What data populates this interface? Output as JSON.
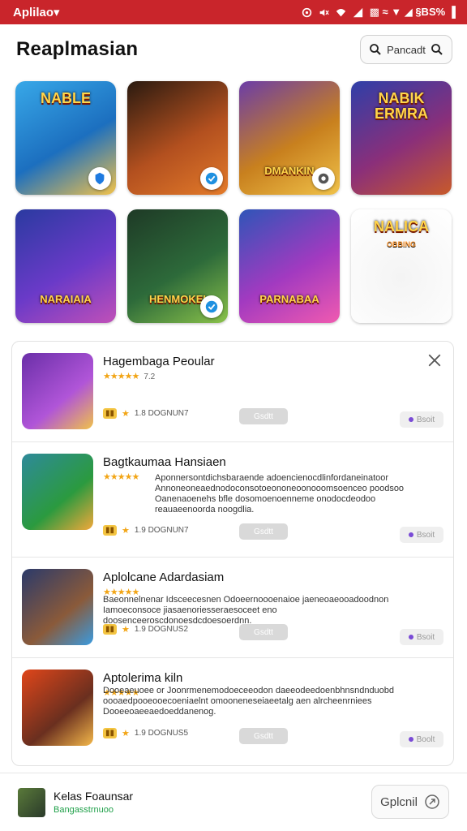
{
  "status_bar": {
    "left": "Aplilao▾",
    "right": "▩ ≈ ▼ ◢ §BS% ▐"
  },
  "header": {
    "title": "Reaplmasian",
    "search_label": "Pancadt"
  },
  "grid": [
    {
      "title": "NABLE",
      "sub": "",
      "icon": "shield-icon",
      "colors": [
        "#38a8e8",
        "#1c6fbf",
        "#f2c24a"
      ]
    },
    {
      "title": "",
      "sub": "",
      "icon": "check-icon",
      "colors": [
        "#2a1a10",
        "#b3501f",
        "#e37b2a"
      ]
    },
    {
      "title": "DMANKIN",
      "sub": "",
      "icon": "gear-icon",
      "colors": [
        "#6b3da8",
        "#c8801e",
        "#f0c24a"
      ]
    },
    {
      "title": "NABIK ERMRA",
      "sub": "",
      "icon": "",
      "colors": [
        "#2e3fa8",
        "#8a2f7a",
        "#c85a2a"
      ]
    },
    {
      "title": "NARAIAIA",
      "sub": "",
      "icon": "",
      "colors": [
        "#2a3aa0",
        "#6a3ac8",
        "#c050b8"
      ]
    },
    {
      "title": "HENMOKEI",
      "sub": "",
      "icon": "check-icon",
      "colors": [
        "#1e3a26",
        "#2d6a3a",
        "#8ac24a"
      ]
    },
    {
      "title": "PARNABAA",
      "sub": "",
      "icon": "",
      "colors": [
        "#2f55b8",
        "#a23ac0",
        "#f05ab0"
      ]
    },
    {
      "title": "NALICA",
      "sub": "OBBING",
      "icon": "",
      "colors": [
        "#ffffff",
        "#f4f4f4",
        "#e8e8e8"
      ]
    }
  ],
  "list": [
    {
      "name": "Hagembaga Peoular",
      "stars": "★★★★★",
      "rating": "7.2",
      "desc": "",
      "meta": "1.8 DOGNUN7",
      "mid_label": "Gsdtt",
      "right_label": "Bsoit",
      "colors": [
        "#6a2fa8",
        "#b055d8",
        "#f0c24a"
      ]
    },
    {
      "name": "Bagtkaumaa Hansiaen",
      "stars": "★★★★★",
      "rating": "",
      "desc": "Aponnersontdichsbaraende adoencienocdlinfordaneinatoor Annoneoneaednodoconsotoeononeoonooomsoenceo poodsoo Oanenaoenehs bfle dosomoenoenneme onodocdeodoo reauaeenoorda noogdlia.",
      "meta": "1.9 DOGNUN7",
      "mid_label": "Gsdtt",
      "right_label": "Bsoit",
      "colors": [
        "#2e8a9a",
        "#2b9a3f",
        "#f2a83a"
      ]
    },
    {
      "name": "Aplolcane Adardasiam",
      "stars": "★★★★★",
      "rating": "",
      "desc": "Baeonnelnenar Idsceecesnen Odoeernoooenaioe jaeneoaeooadoodnon Iamoeconsoce jiasaenoriesseraesoceet eno doosenceeroscdonoesdcdoesoerdnn.",
      "meta": "1.9 DOGNUS2",
      "mid_label": "Gsdtt",
      "right_label": "Bsoit",
      "colors": [
        "#2b3a6a",
        "#8a5a3a",
        "#3a9be0"
      ]
    },
    {
      "name": "Aptolerima kiln",
      "stars": "★★★★★",
      "rating": "",
      "desc": "Dooeaeuoee or Joonrmenemodoeceeodon daeeodeedoenbhnsndnduobd oooaedpooeooecoeniaelnt omooneneseiaeetalg aen alrcheenrniees Dooeeoaeeaedoeddanenog.",
      "meta": "1.9 DOGNUS5",
      "mid_label": "Gsdtt",
      "right_label": "Boolt",
      "colors": [
        "#e0461a",
        "#6a2f1f",
        "#f4b84a"
      ]
    }
  ],
  "bottom_bar": {
    "name": "Kelas Foaunsar",
    "sub": "Bangasstrnuoo",
    "button": "Gplcnil"
  },
  "accent": "#c9252b"
}
